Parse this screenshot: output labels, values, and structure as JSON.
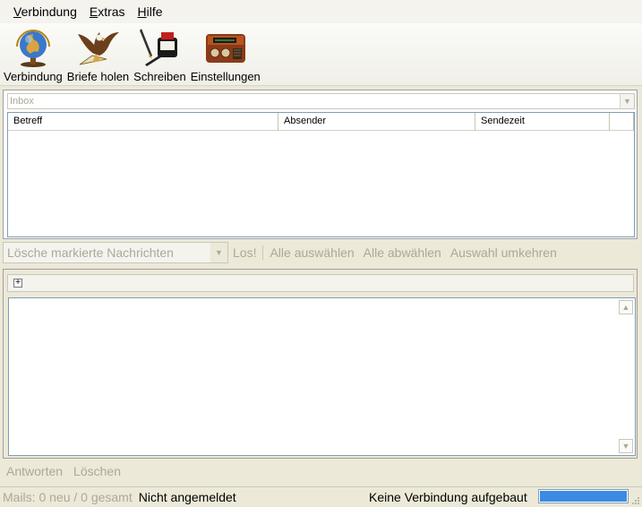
{
  "menu": {
    "items": [
      {
        "accel": "V",
        "rest": "erbindung"
      },
      {
        "accel": "E",
        "rest": "xtras"
      },
      {
        "accel": "H",
        "rest": "ilfe"
      }
    ]
  },
  "toolbar": {
    "connect_label": "Verbindung",
    "connect_icon": "globe-icon",
    "fetch_label": "Briefe holen",
    "fetch_icon": "eagle-icon",
    "write_label": "Schreiben",
    "write_icon": "inkwell-pen-icon",
    "settings_label": "Einstellungen",
    "settings_icon": "radio-icon"
  },
  "folder": {
    "selected": "Inbox"
  },
  "message_list": {
    "columns": [
      "Betreff",
      "Absender",
      "Sendezeit"
    ],
    "rows": []
  },
  "actions": {
    "bulk_select_value": "Lösche markierte Nachrichten",
    "go_label": "Los!",
    "select_all_label": "Alle auswählen",
    "deselect_all_label": "Alle abwählen",
    "invert_label": "Auswahl umkehren"
  },
  "preview": {
    "expand_symbol": "+"
  },
  "reply": {
    "answer_label": "Antworten",
    "delete_label": "Löschen"
  },
  "status": {
    "mail_count": "Mails: 0 neu / 0 gesamt",
    "login_state": "Nicht angemeldet",
    "connection_state": "Keine Verbindung aufgebaut",
    "progress_fraction": 1.0,
    "progress_color": "#3c8be2"
  }
}
